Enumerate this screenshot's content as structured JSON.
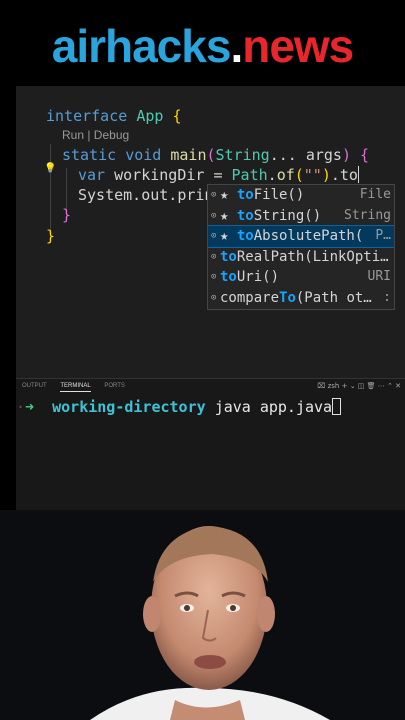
{
  "banner": {
    "brand_left": "airhacks",
    "brand_dot": ".",
    "brand_right": "news"
  },
  "editor": {
    "line1": {
      "kw": "interface",
      "name": "App",
      "brace": "{"
    },
    "codelens": "Run | Debug",
    "line2": {
      "kw1": "static",
      "kw2": "void",
      "method": "main",
      "paren": "(",
      "type": "String",
      "rest": "... args",
      "paren2": ")",
      "brace": "{"
    },
    "line3": {
      "kw": "var",
      "text": "workingDir = ",
      "cls": "Path",
      "dot": ".",
      "method": "of",
      "paren": "(",
      "str": "\"\"",
      "paren2": ")",
      "typed": ".to"
    },
    "line4": {
      "text": "System.out.print"
    },
    "close_inner": "}",
    "close_outer": "}"
  },
  "suggest": {
    "highlight_prefix": "to",
    "items": [
      {
        "icon": "⊙",
        "star": "★ ",
        "rest": "File()",
        "detail": "File"
      },
      {
        "icon": "⊙",
        "star": "★ ",
        "rest": "String()",
        "detail": "String"
      },
      {
        "icon": "⊙",
        "star": "★ ",
        "rest": "AbsolutePath(",
        "detail": "P…"
      },
      {
        "icon": "⊙",
        "star": "",
        "rest": "RealPath(LinkOpti…",
        "detail": ""
      },
      {
        "icon": "⊙",
        "star": "",
        "rest": "Uri()",
        "detail": "URI"
      },
      {
        "icon": "⊙",
        "star": "",
        "pre": "compare",
        "rest": "(Path ot…",
        "detail": ":"
      }
    ]
  },
  "panel": {
    "tabs": [
      "OUTPUT",
      "TERMINAL",
      "PORTS"
    ],
    "active_tab": "TERMINAL",
    "shell": "zsh",
    "prompt_arrow": "➜",
    "directory": "working-directory",
    "command": "java app.java"
  },
  "colors": {
    "accent": "#2aa4dc",
    "news": "#e8262b",
    "selection": "#04395e",
    "match": "#18a3ff"
  }
}
